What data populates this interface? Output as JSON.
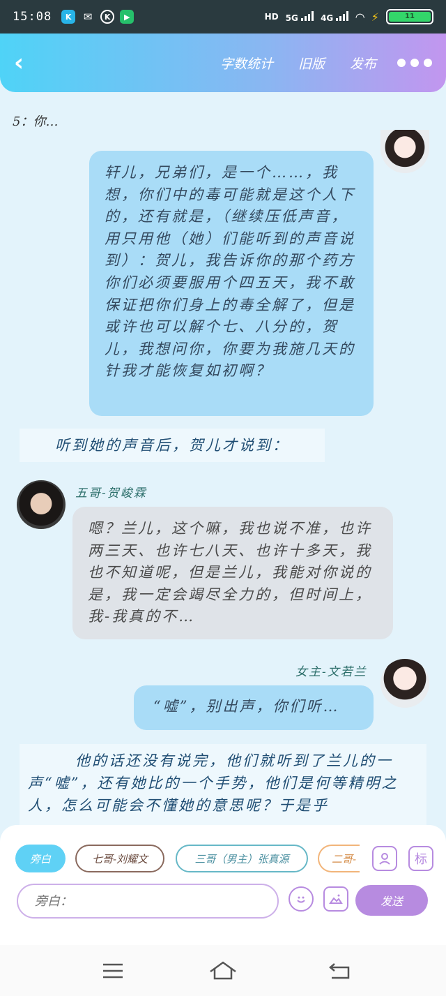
{
  "status_bar": {
    "time": "15:08",
    "network_hd": "HD",
    "network_5g": "5G",
    "network_4g": "4G",
    "battery": "11"
  },
  "header": {
    "word_count": "字数统计",
    "old_version": "旧版",
    "publish": "发布"
  },
  "chat": {
    "prev_line": "5：你…",
    "msg1": "轩儿，兄弟们，是一个……，我想，你们中的毒可能就是这个人下的，还有就是，（继续压低声音，用只用他（她）们能听到的声音说到）：贺儿，我告诉你的那个药方你们必须要服用个四五天，我不敢保证把你们身上的毒全解了，但是或许也可以解个七、八分的，贺儿，我想问你，你要为我施几天的针我才能恢复如初啊？",
    "narration1": "听到她的声音后，贺儿才说到：",
    "name2": "五哥-贺峻霖",
    "msg2": "嗯？兰儿，这个嘛，我也说不准，也许两三天、也许七八天、也许十多天，我也不知道呢，但是兰儿，我能对你说的是，我一定会竭尽全力的，但时间上，我-我真的不…",
    "name3": "女主-文若兰",
    "msg3": "“嘘”，别出声，你们听…",
    "narration2": "他的话还没有说完，他们就听到了兰儿的一声“嘘”，还有她比的一个手势，他们是何等精明之人，怎么可能会不懂她的意思呢？于是乎"
  },
  "panel": {
    "chips": [
      "旁白",
      "七哥-刘耀文",
      "三哥（男主）张真源",
      "二哥-"
    ],
    "tag_icon": "标",
    "input_placeholder": "旁白：",
    "send_label": "发送"
  },
  "icons": {
    "back": "chevron-left-icon",
    "more": "more-dots-icon",
    "emoji": "emoji-icon",
    "image": "image-icon",
    "person": "person-card-icon"
  },
  "colors": {
    "header_start": "#4fd3f7",
    "header_end": "#c296ef",
    "bubble_blue": "#a9dcf7",
    "bubble_gray": "#dfe3e8",
    "accent_purple": "#b78be0"
  }
}
